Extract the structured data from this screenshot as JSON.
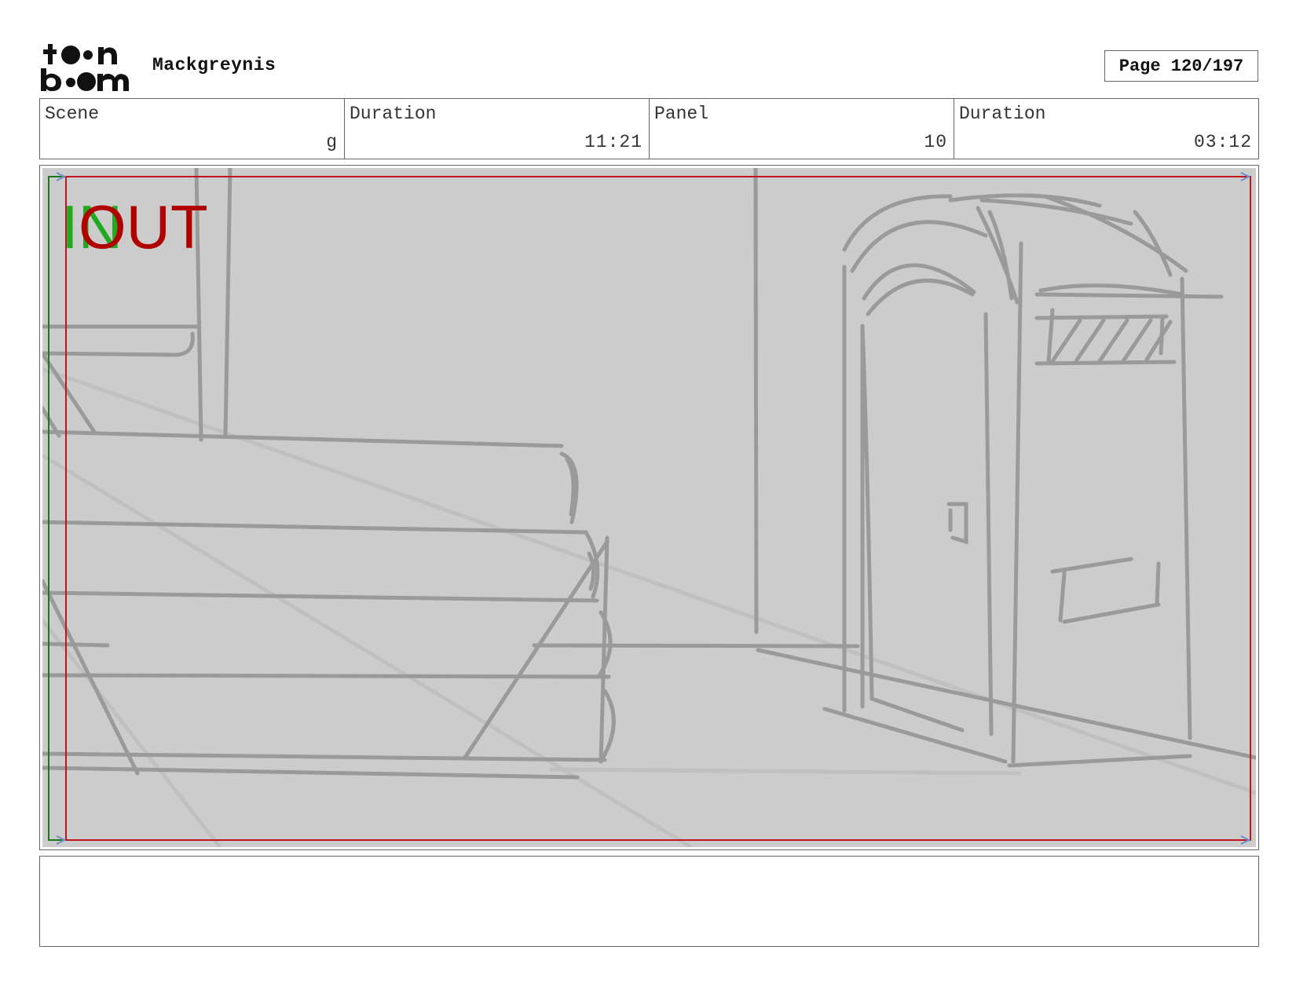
{
  "header": {
    "logo_text": "toon boom",
    "project_title": "Mackgreynis",
    "page_number": "Page 120/197"
  },
  "info": {
    "scene_label": "Scene",
    "scene_value": "g",
    "scene_duration_label": "Duration",
    "scene_duration_value": "11:21",
    "panel_label": "Panel",
    "panel_value": "10",
    "panel_duration_label": "Duration",
    "panel_duration_value": "03:12"
  },
  "panel": {
    "in_marker": "IN",
    "out_marker": "OUT",
    "colors": {
      "background": "#cccccc",
      "sketch": "#9a9a9a",
      "in_color": "#1faa1f",
      "out_color": "#b00000"
    }
  },
  "notes": {
    "text": ""
  }
}
